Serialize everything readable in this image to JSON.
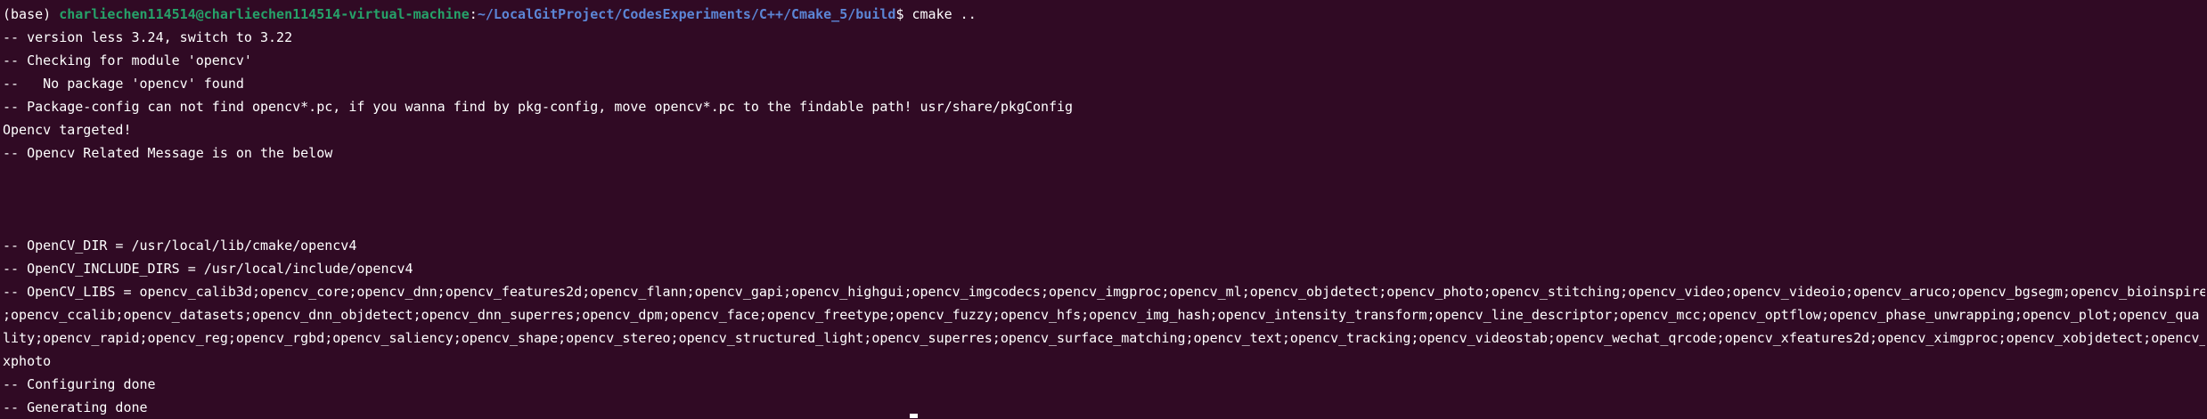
{
  "prompt": {
    "env": "(base) ",
    "user_host": "charliechen114514@charliechen114514-virtual-machine",
    "colon": ":",
    "path": "~/LocalGitProject/CodesExperiments/C++/Cmake_5/build",
    "symbol": "$ ",
    "command": "cmake .."
  },
  "output_lines": [
    "-- version less 3.24, switch to 3.22",
    "-- Checking for module 'opencv'",
    "--   No package 'opencv' found",
    "-- Package-config can not find opencv*.pc, if you wanna find by pkg-config, move opencv*.pc to the findable path! usr/share/pkgConfig",
    "Opencv targeted!",
    "-- Opencv Related Message is on the below",
    "",
    "",
    "",
    "-- OpenCV_DIR = /usr/local/lib/cmake/opencv4",
    "-- OpenCV_INCLUDE_DIRS = /usr/local/include/opencv4",
    "-- OpenCV_LIBS = opencv_calib3d;opencv_core;opencv_dnn;opencv_features2d;opencv_flann;opencv_gapi;opencv_highgui;opencv_imgcodecs;opencv_imgproc;opencv_ml;opencv_objdetect;opencv_photo;opencv_stitching;opencv_video;opencv_videoio;opencv_aruco;opencv_bgsegm;opencv_bioinspired",
    ";opencv_ccalib;opencv_datasets;opencv_dnn_objdetect;opencv_dnn_superres;opencv_dpm;opencv_face;opencv_freetype;opencv_fuzzy;opencv_hfs;opencv_img_hash;opencv_intensity_transform;opencv_line_descriptor;opencv_mcc;opencv_optflow;opencv_phase_unwrapping;opencv_plot;opencv_qua",
    "lity;opencv_rapid;opencv_reg;opencv_rgbd;opencv_saliency;opencv_shape;opencv_stereo;opencv_structured_light;opencv_superres;opencv_surface_matching;opencv_text;opencv_tracking;opencv_videostab;opencv_wechat_qrcode;opencv_xfeatures2d;opencv_ximgproc;opencv_xobjdetect;opencv_",
    "xphoto",
    "-- Configuring done",
    "-- Generating done"
  ],
  "colors": {
    "background": "#300a24",
    "user_host": "#26a269",
    "path": "#5c86d6",
    "text": "#ffffff"
  }
}
